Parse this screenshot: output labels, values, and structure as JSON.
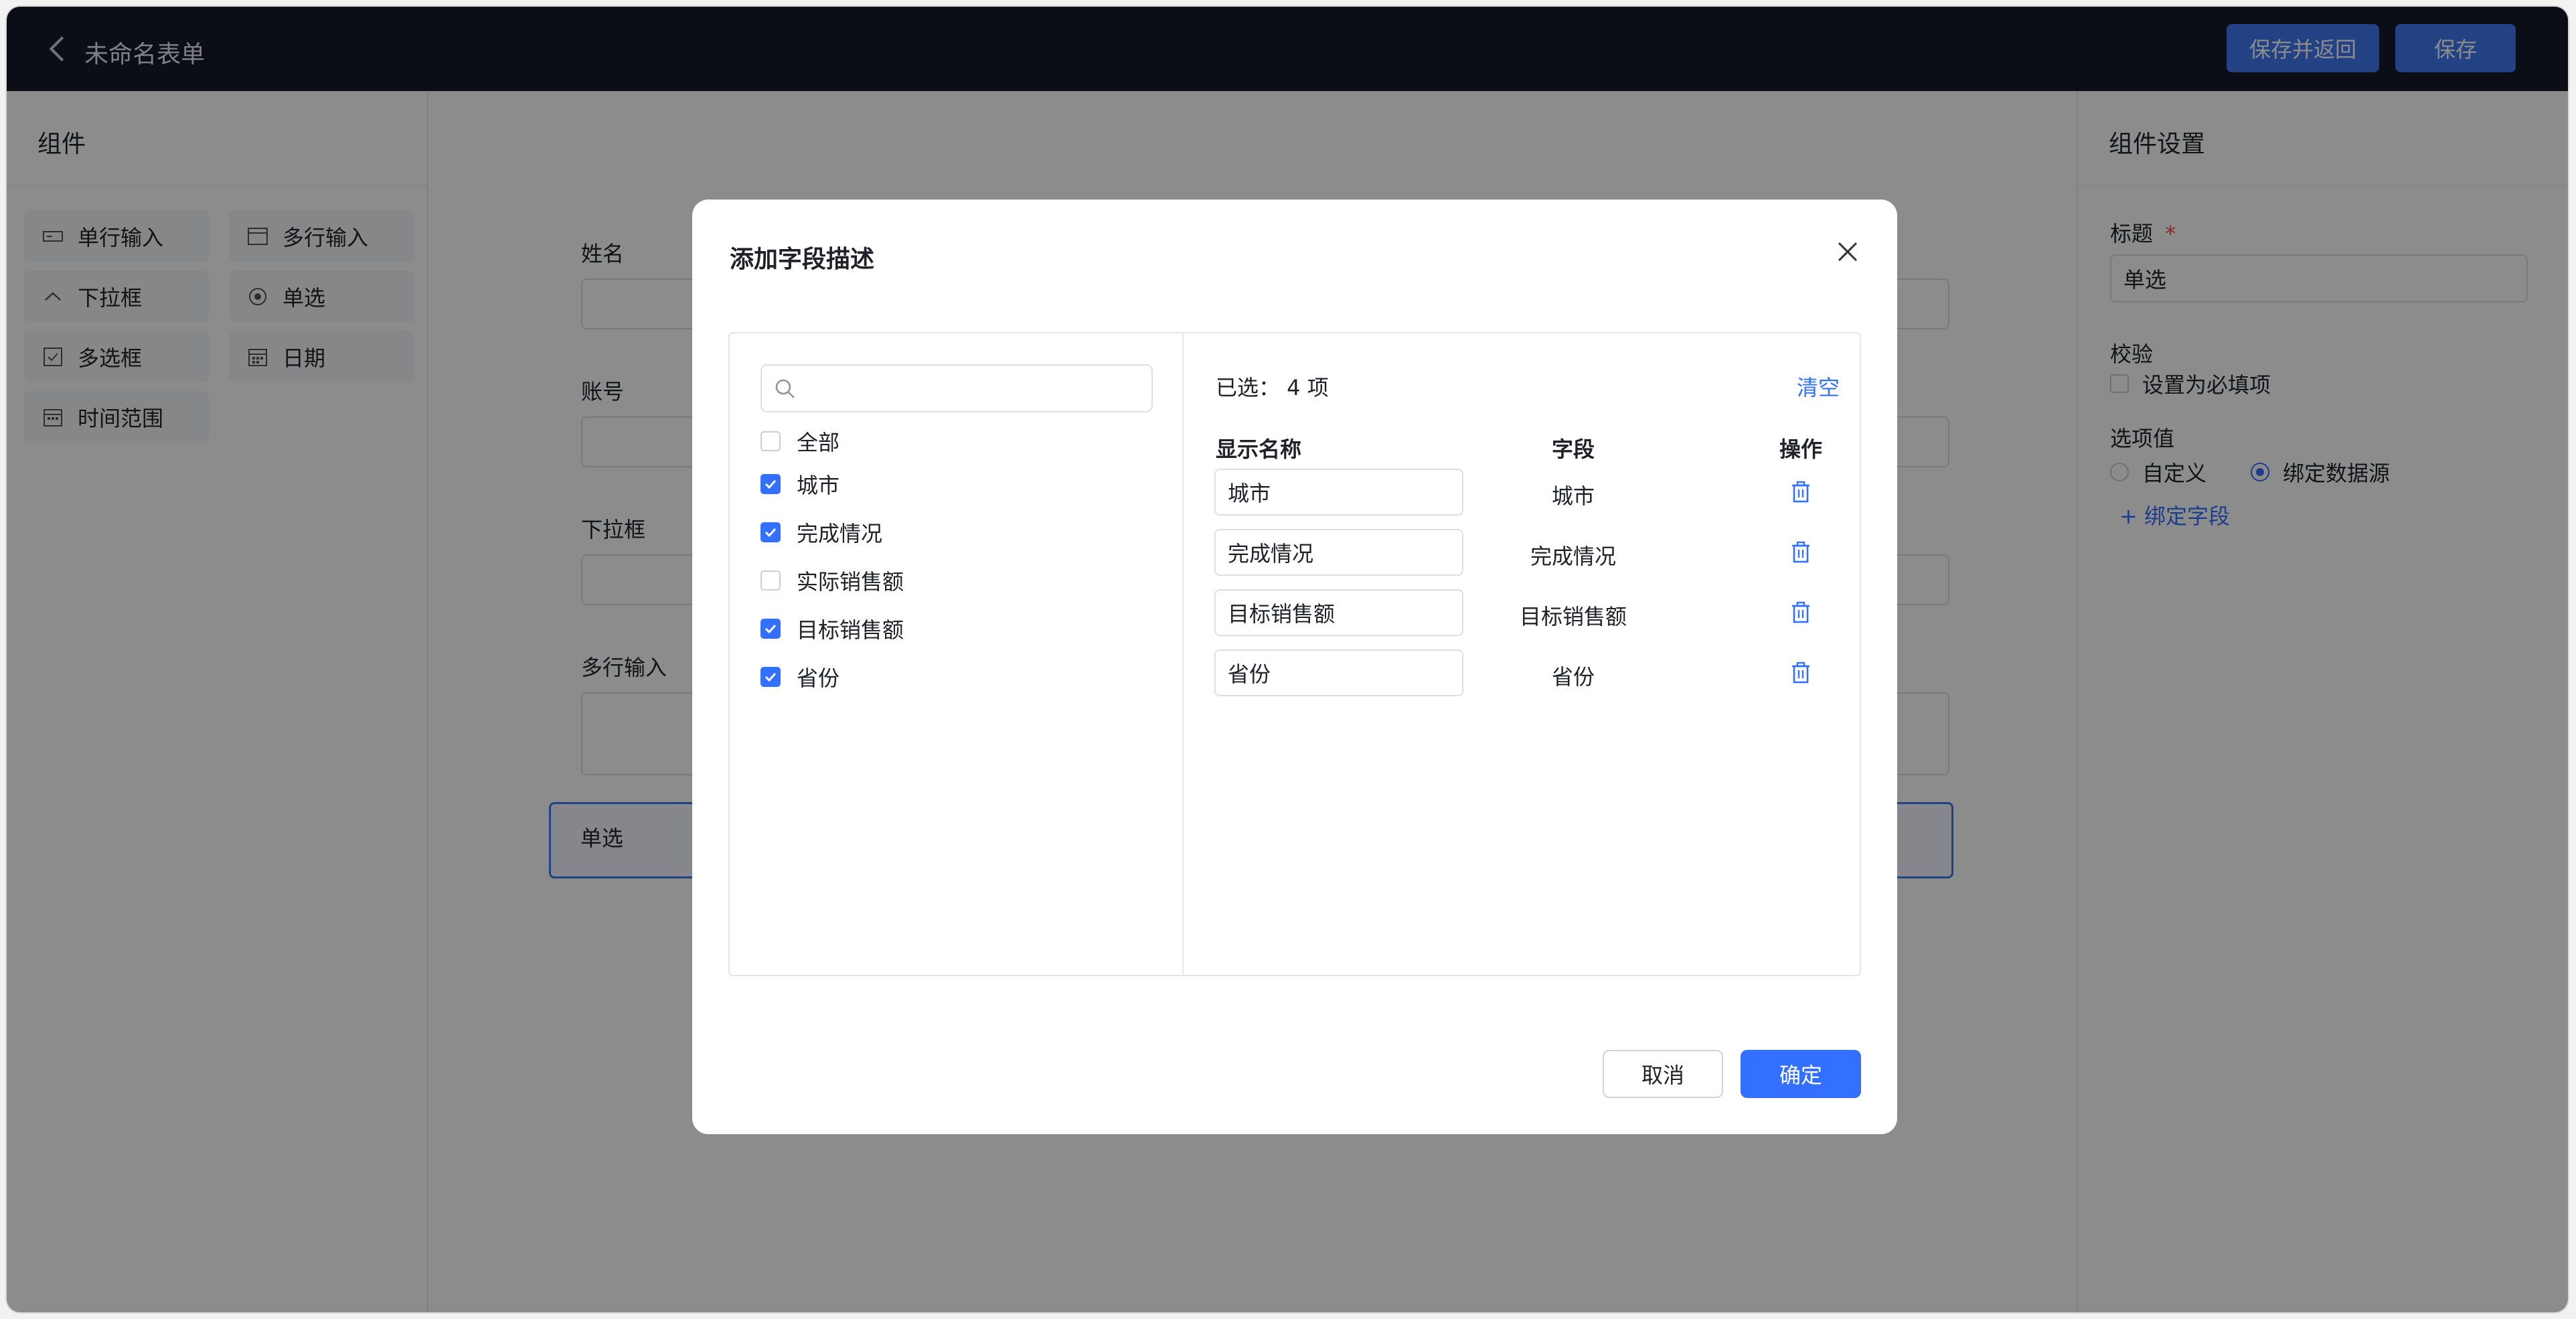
{
  "header": {
    "title": "未命名表单",
    "save_and_return": "保存并返回",
    "save": "保存"
  },
  "left_panel": {
    "title": "组件",
    "components": [
      {
        "label": "单行输入",
        "icon": "single-line-input-icon"
      },
      {
        "label": "多行输入",
        "icon": "multi-line-input-icon"
      },
      {
        "label": "下拉框",
        "icon": "dropdown-icon"
      },
      {
        "label": "单选",
        "icon": "radio-icon"
      },
      {
        "label": "多选框",
        "icon": "checkbox-icon"
      },
      {
        "label": "日期",
        "icon": "calendar-icon"
      },
      {
        "label": "时间范围",
        "icon": "time-range-icon"
      }
    ]
  },
  "canvas": {
    "fields": [
      {
        "label": "姓名"
      },
      {
        "label": "账号"
      },
      {
        "label": "下拉框"
      },
      {
        "label": "多行输入"
      }
    ],
    "radio_block_label": "单选"
  },
  "right_panel": {
    "title": "组件设置",
    "title_label": "标题",
    "required_mark": "*",
    "title_value": "单选",
    "validation_label": "校验",
    "required_checkbox": "设置为必填项",
    "options_label": "选项值",
    "option_custom": "自定义",
    "option_bind": "绑定数据源",
    "bind_field_link": "+ 绑定字段"
  },
  "modal": {
    "title": "添加字段描述",
    "search": {
      "value": "",
      "placeholder": ""
    },
    "checkbox_all": "全部",
    "field_options": [
      {
        "label": "城市",
        "checked": true
      },
      {
        "label": "完成情况",
        "checked": true
      },
      {
        "label": "实际销售额",
        "checked": false
      },
      {
        "label": "目标销售额",
        "checked": true
      },
      {
        "label": "省份",
        "checked": true
      }
    ],
    "selected_summary": "已选： 4 项",
    "clear": "清空",
    "columns": {
      "display_name": "显示名称",
      "field": "字段",
      "action": "操作"
    },
    "rows": [
      {
        "display_name": "城市",
        "field": "城市"
      },
      {
        "display_name": "完成情况",
        "field": "完成情况"
      },
      {
        "display_name": "目标销售额",
        "field": "目标销售额"
      },
      {
        "display_name": "省份",
        "field": "省份"
      }
    ],
    "cancel": "取消",
    "confirm": "确定"
  },
  "colors": {
    "primary": "#3370ff",
    "header_bg": "#151a2b",
    "overlay": "rgba(0,0,0,0.45)"
  }
}
